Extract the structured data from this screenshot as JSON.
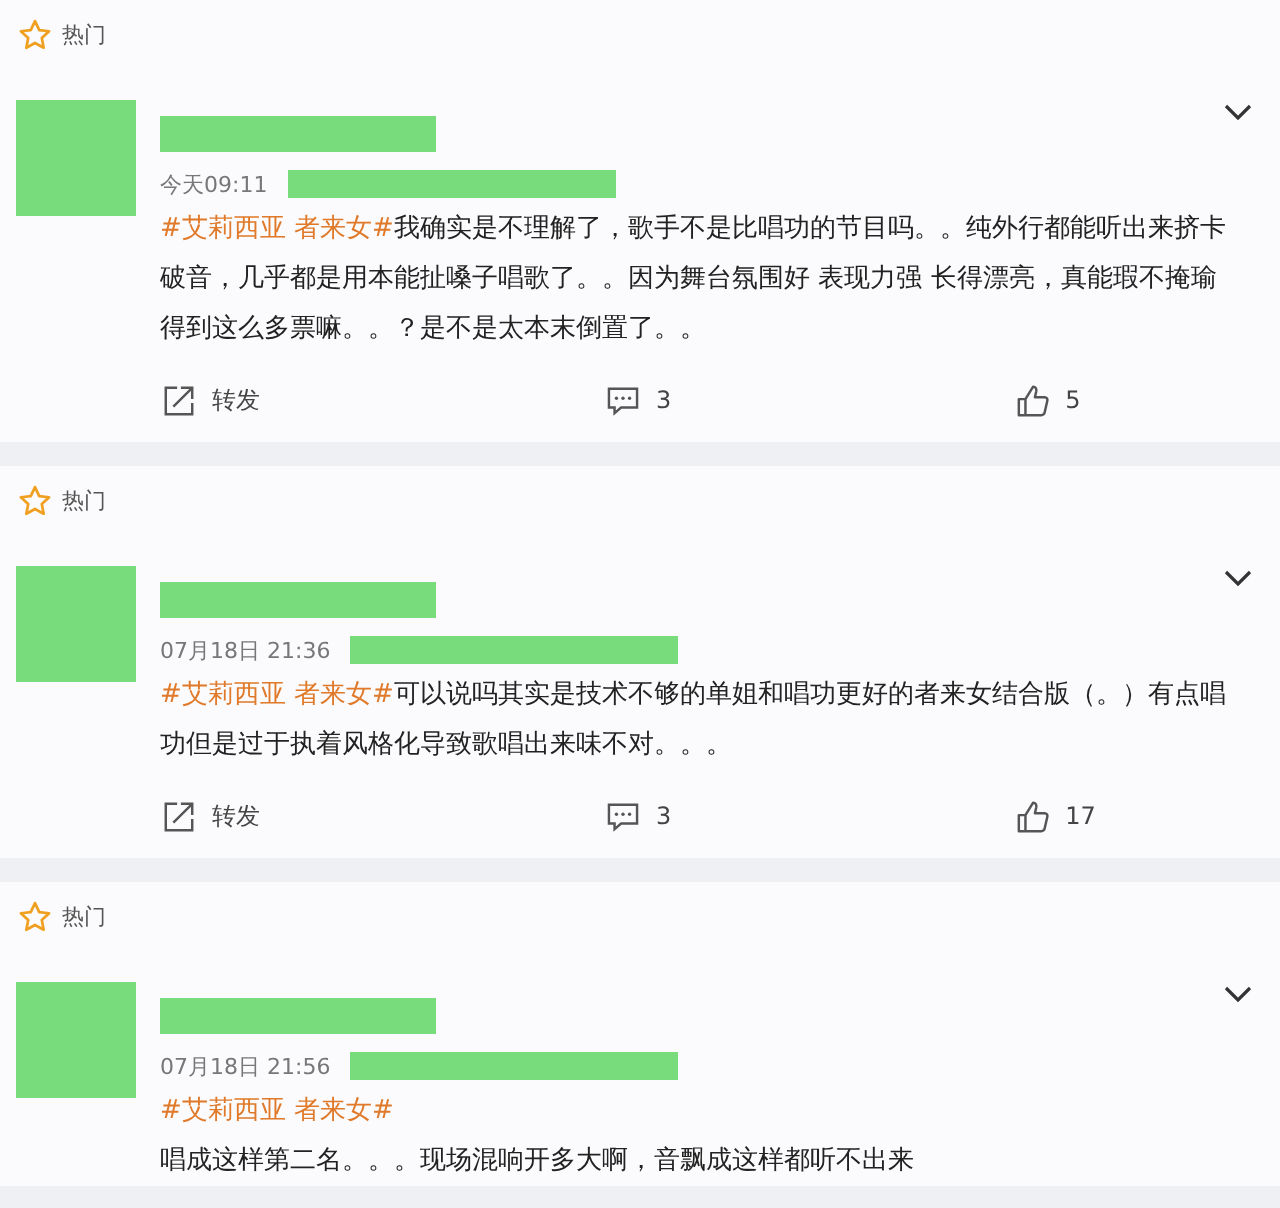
{
  "comments": [
    {
      "label": "热门",
      "time": "今天09:11",
      "hashtag": "#艾莉西亚 者来女#",
      "text": "我确实是不理解了，歌手不是比唱功的节目吗。。纯外行都能听出来挤卡破音，几乎都是用本能扯嗓子唱歌了。。因为舞台氛围好 表现力强 长得漂亮，真能瑕不掩瑜得到这么多票嘛。。？是不是太本末倒置了。。",
      "text_on_new_line": false,
      "actions": {
        "repost": "转发",
        "comments": "3",
        "likes": "5"
      }
    },
    {
      "label": "热门",
      "time": "07月18日 21:36",
      "hashtag": "#艾莉西亚 者来女#",
      "text": "可以说吗其实是技术不够的单姐和唱功更好的者来女结合版（。）有点唱功但是过于执着风格化导致歌唱出来味不对。。。",
      "text_on_new_line": false,
      "actions": {
        "repost": "转发",
        "comments": "3",
        "likes": "17"
      }
    },
    {
      "label": "热门",
      "time": "07月18日 21:56",
      "hashtag": "#艾莉西亚 者来女#",
      "text": "唱成这样第二名。。。现场混响开多大啊，音飘成这样都听不出来",
      "text_on_new_line": true
    }
  ]
}
